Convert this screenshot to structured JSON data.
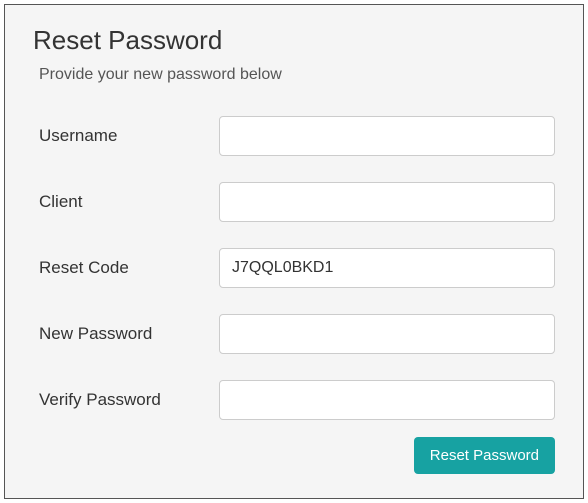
{
  "header": {
    "title": "Reset Password",
    "subtitle": "Provide your new password below"
  },
  "form": {
    "username": {
      "label": "Username",
      "value": ""
    },
    "client": {
      "label": "Client",
      "value": ""
    },
    "reset_code": {
      "label": "Reset Code",
      "value": "J7QQL0BKD1"
    },
    "new_password": {
      "label": "New Password",
      "value": ""
    },
    "verify_password": {
      "label": "Verify Password",
      "value": ""
    }
  },
  "actions": {
    "submit_label": "Reset Password"
  }
}
